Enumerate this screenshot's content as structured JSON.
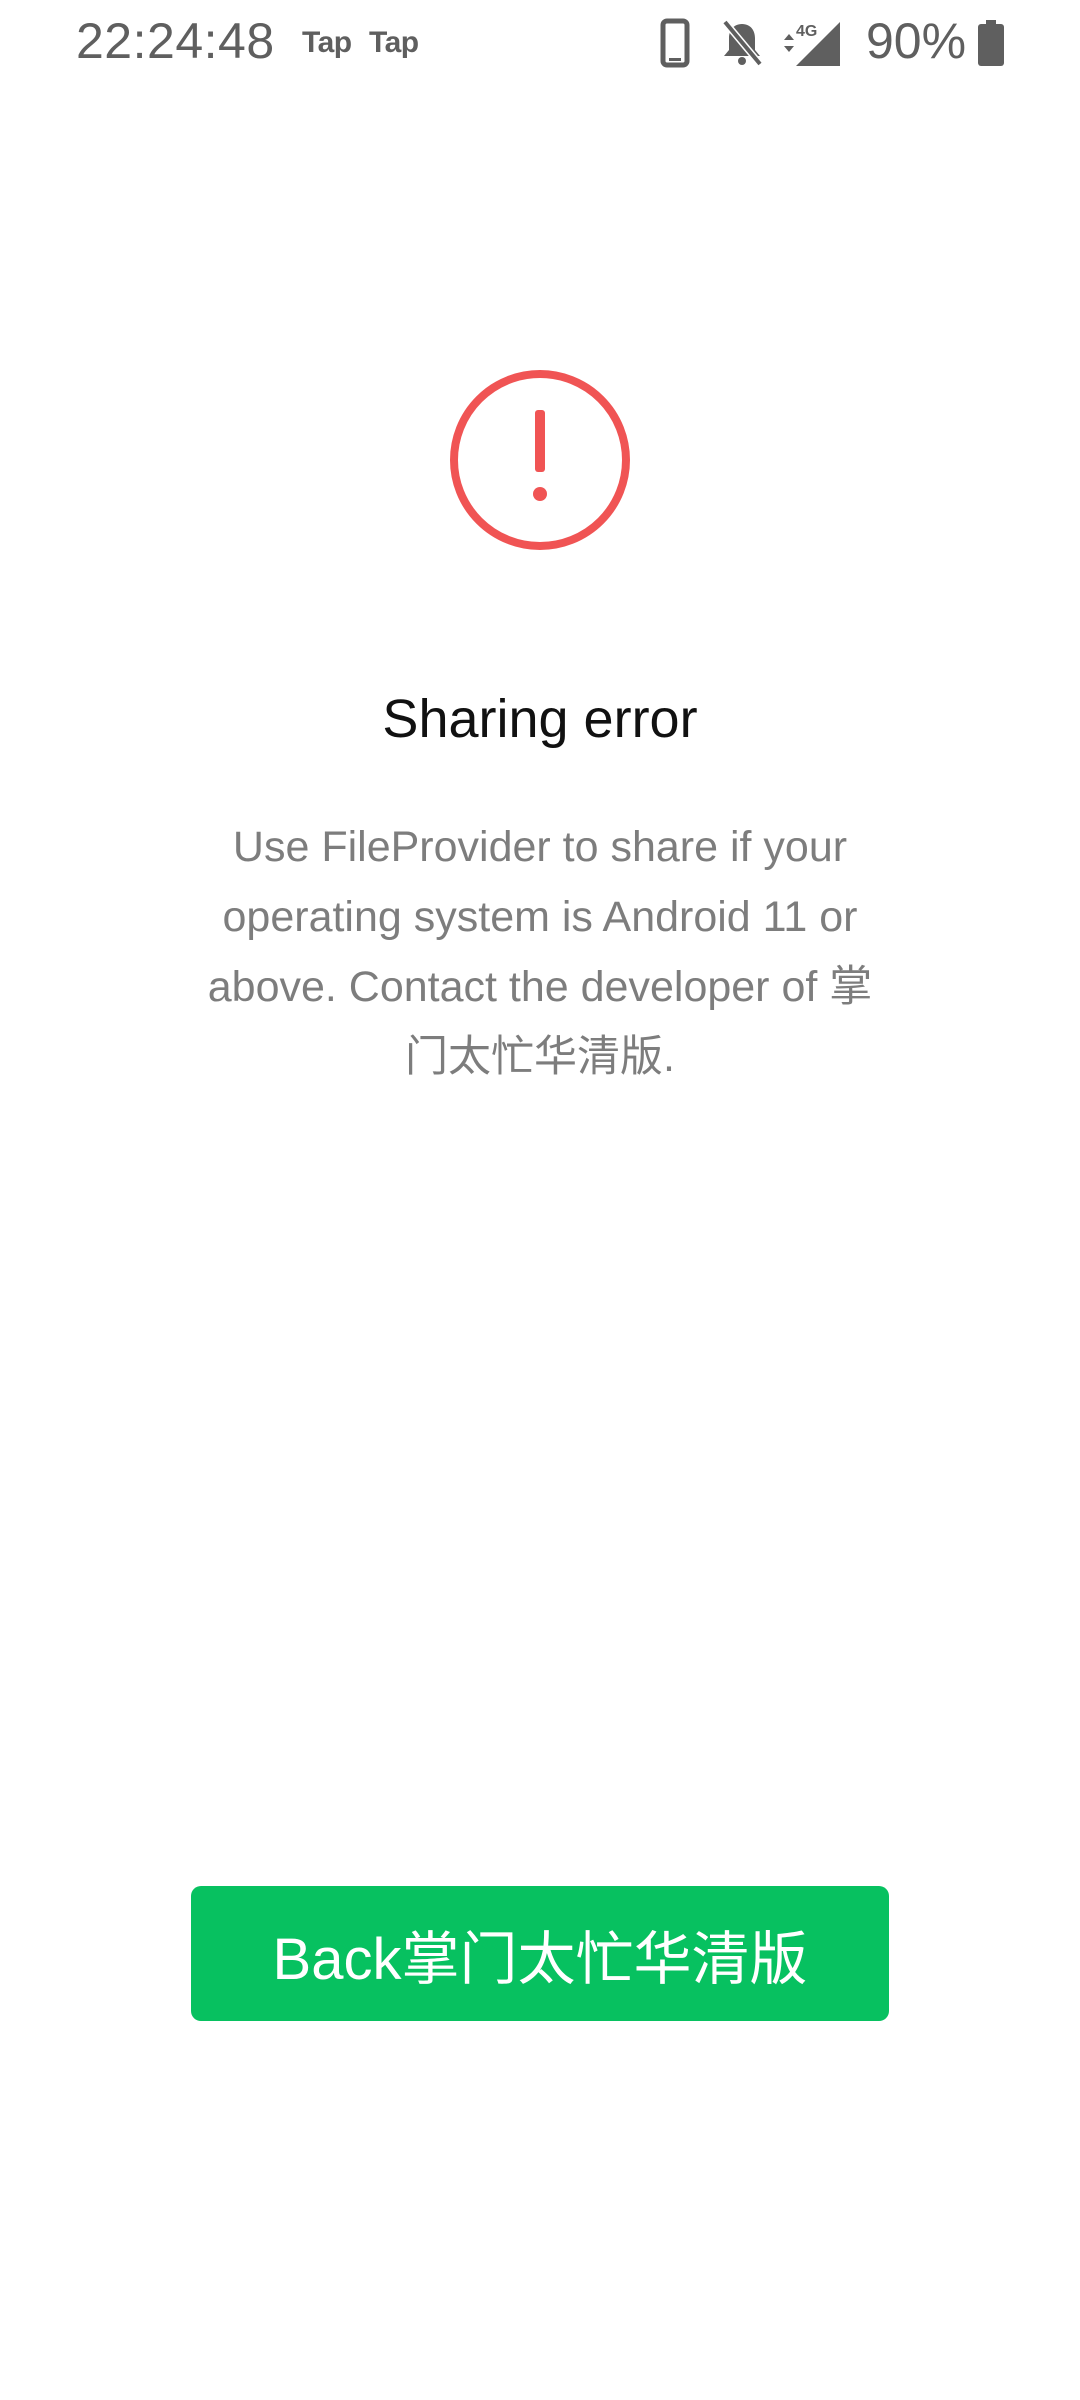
{
  "status_bar": {
    "time": "22:24:48",
    "notifications": [
      "Tap",
      "Tap"
    ],
    "network": "4G",
    "battery": "90%",
    "icons": [
      "phone-icon",
      "bell-muted-icon",
      "signal-4g-icon",
      "battery-icon"
    ]
  },
  "error": {
    "icon": "error-circle-exclamation-icon",
    "title": "Sharing error",
    "message": "Use FileProvider to share if your operating system is Android 11 or above. Contact the developer of 掌门太忙华清版."
  },
  "actions": {
    "back_label": "Back掌门太忙华清版"
  },
  "colors": {
    "accent_green": "#07c160",
    "error_red": "#f05454",
    "text_primary": "#111111",
    "text_secondary": "#7d7d7d",
    "status_text": "#5f5f5f"
  }
}
